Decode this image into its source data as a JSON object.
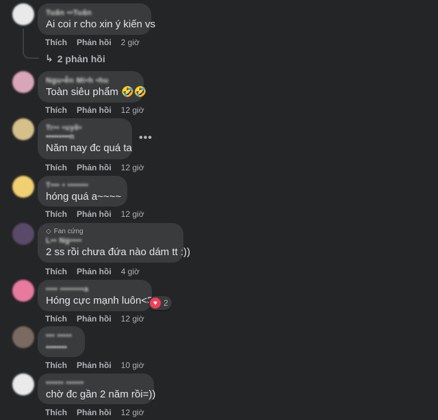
{
  "actions": {
    "like": "Thích",
    "reply": "Phản hồi"
  },
  "colors": {
    "background": "#242526",
    "bubble": "#3a3b3c",
    "heart": "#f33e58"
  },
  "comments": [
    {
      "name": "Tuấn ••Tuấn",
      "text": "Ai coi r cho xin ý kiến vs",
      "time": "2 giờ",
      "replies": "2 phản hồi",
      "avatar_color": "#e9e9e9"
    },
    {
      "name": "Ngu•ễn Mi•h •hu",
      "text": "Toàn siêu phẩm 🤣🤣",
      "time": "12 giờ",
      "avatar_color": "#d9a5b8"
    },
    {
      "name": "Tr•• •uyề•",
      "name_line2": "•••••••••n",
      "text": "Năm nay đc quá ta",
      "time": "12 giờ",
      "more": "•••",
      "avatar_color": "#d6c08a"
    },
    {
      "name": "T••• • •••••••",
      "text": "hóng quá a~~~~",
      "time": "12 giờ",
      "avatar_color": "#f0d070"
    },
    {
      "badge": "Fan cứng",
      "name": "L•• Ng••••",
      "text": "2 ss rồi chưa đứa nào dám tt :))",
      "time": "4 giờ",
      "avatar_color": "#5a4a6a"
    },
    {
      "name": "•••• ••••••••a",
      "text": "Hóng cực mạnh luôn<3",
      "time": "12 giờ",
      "reaction_count": "2",
      "avatar_color": "#e87aa0"
    },
    {
      "name": "••• •••••",
      "name_line2": "••••••••",
      "text": "",
      "time": "10 giờ",
      "avatar_color": "#7a6a60"
    },
    {
      "name": "•••••• ••••••",
      "text": "chờ đc gần 2 năm rồi=))",
      "time": "12 giờ",
      "avatar_color": "#eaeaea"
    }
  ]
}
